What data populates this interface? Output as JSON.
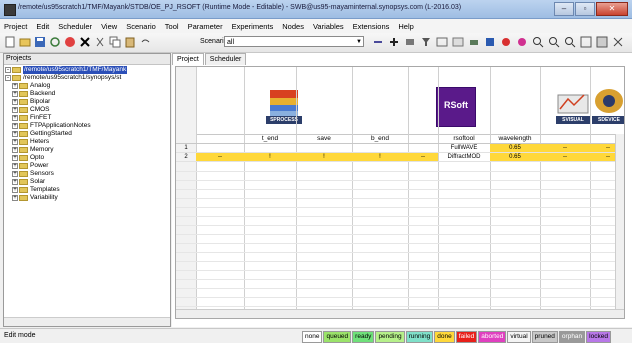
{
  "window": {
    "title": "/remote/us95scratch1/TMF/Mayank/STDB/OE_PJ_RSOFT (Runtime Mode - Editable) - SWB@us95-mayaminternal.synopsys.com (L-2016.03)",
    "buttons": {
      "minimize": "–",
      "maximize": "▫",
      "close": "✕"
    }
  },
  "menu": [
    "Project",
    "Edit",
    "Scheduler",
    "View",
    "Scenario",
    "Tool",
    "Parameter",
    "Experiments",
    "Nodes",
    "Variables",
    "Extensions",
    "Help"
  ],
  "toolbar": {
    "scenario_label": "Scenario:",
    "scenario_value": "all"
  },
  "projects": {
    "header": "Projects",
    "tree": [
      {
        "label": "/remote/us95scratch1/TMF/Mayank",
        "level": 0,
        "expander": "-",
        "selected": true
      },
      {
        "label": "/remote/us95scratch1/synopsys/st",
        "level": 0,
        "expander": "-",
        "selected": false
      },
      {
        "label": "Analog",
        "level": 1,
        "expander": "+",
        "selected": false
      },
      {
        "label": "Backend",
        "level": 1,
        "expander": "+",
        "selected": false
      },
      {
        "label": "Bipolar",
        "level": 1,
        "expander": "+",
        "selected": false
      },
      {
        "label": "CMOS",
        "level": 1,
        "expander": "+",
        "selected": false
      },
      {
        "label": "FinFET",
        "level": 1,
        "expander": "+",
        "selected": false
      },
      {
        "label": "FTPApplicationNotes",
        "level": 1,
        "expander": "+",
        "selected": false
      },
      {
        "label": "GettingStarted",
        "level": 1,
        "expander": "+",
        "selected": false
      },
      {
        "label": "Heters",
        "level": 1,
        "expander": "+",
        "selected": false
      },
      {
        "label": "Memory",
        "level": 1,
        "expander": "+",
        "selected": false
      },
      {
        "label": "Opto",
        "level": 1,
        "expander": "+",
        "selected": false
      },
      {
        "label": "Power",
        "level": 1,
        "expander": "+",
        "selected": false
      },
      {
        "label": "Sensors",
        "level": 1,
        "expander": "+",
        "selected": false
      },
      {
        "label": "Solar",
        "level": 1,
        "expander": "+",
        "selected": false
      },
      {
        "label": "Templates",
        "level": 1,
        "expander": "+",
        "selected": false
      },
      {
        "label": "Variability",
        "level": 1,
        "expander": "+",
        "selected": false
      }
    ]
  },
  "tabs": [
    "Project",
    "Scheduler"
  ],
  "grid": {
    "tools": [
      {
        "name": "SPROCESS",
        "icon": "sprocess-icon"
      },
      {
        "name": "RSoft",
        "icon": "rsoft-icon"
      },
      {
        "name": "SVISUAL",
        "icon": "svisual-icon"
      },
      {
        "name": "SDEVICE",
        "icon": "sdevice-icon"
      }
    ],
    "headers": [
      "t_end",
      "save",
      "b_end",
      "rsoftool",
      "wavelength"
    ],
    "rows": [
      {
        "num": "1",
        "c1": "",
        "t_end": "",
        "save": "",
        "b_end": "",
        "c5": "",
        "rsoftool": "FullWAVE",
        "wavelength": "0.65",
        "c8": "--",
        "c9": "--"
      },
      {
        "num": "2",
        "c1": "--",
        "t_end": "!",
        "save": "!",
        "b_end": "!",
        "c5": "--",
        "rsoftool": "DiffractMOD",
        "wavelength": "0.65",
        "c8": "--",
        "c9": "--"
      }
    ]
  },
  "status": {
    "mode": "Edit mode",
    "legend": [
      {
        "label": "none",
        "color": "#ffffff"
      },
      {
        "label": "queued",
        "color": "#9be36a"
      },
      {
        "label": "ready",
        "color": "#6fe07a"
      },
      {
        "label": "pending",
        "color": "#b6f08a"
      },
      {
        "label": "running",
        "color": "#7fe0c9"
      },
      {
        "label": "done",
        "color": "#ffd83a"
      },
      {
        "label": "failed",
        "color": "#e8201a"
      },
      {
        "label": "aborted",
        "color": "#e040c0"
      },
      {
        "label": "virtual",
        "color": "#f4f4f4"
      },
      {
        "label": "pruned",
        "color": "#c8c8c8"
      },
      {
        "label": "orphan",
        "color": "#9a9a9a"
      },
      {
        "label": "locked",
        "color": "#b878e8"
      }
    ]
  }
}
